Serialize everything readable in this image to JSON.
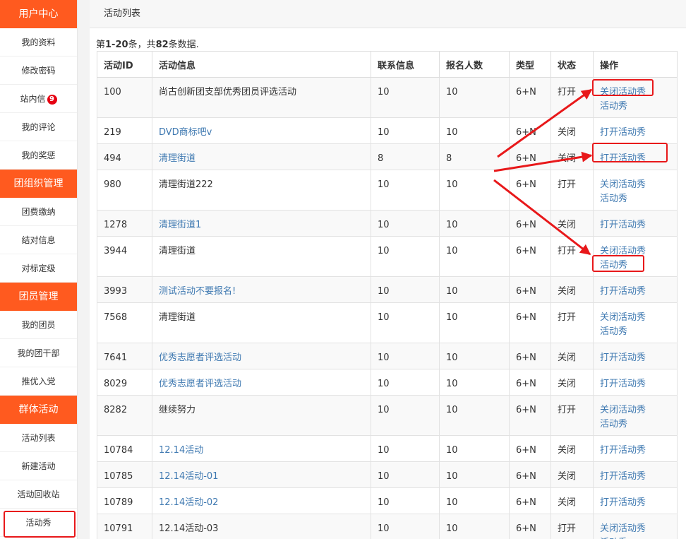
{
  "sidebar": {
    "sections": [
      {
        "title": "用户中心",
        "items": [
          {
            "label": "我的资料"
          },
          {
            "label": "修改密码"
          },
          {
            "label": "站内信",
            "badge": "9"
          },
          {
            "label": "我的评论"
          },
          {
            "label": "我的奖惩"
          }
        ]
      },
      {
        "title": "团组织管理",
        "items": [
          {
            "label": "团费缴纳"
          },
          {
            "label": "结对信息"
          },
          {
            "label": "对标定级"
          }
        ]
      },
      {
        "title": "团员管理",
        "items": [
          {
            "label": "我的团员"
          },
          {
            "label": "我的团干部"
          },
          {
            "label": "推优入党"
          }
        ]
      },
      {
        "title": "群体活动",
        "items": [
          {
            "label": "活动列表"
          },
          {
            "label": "新建活动"
          },
          {
            "label": "活动回收站"
          },
          {
            "label": "活动秀",
            "highlight": true
          }
        ]
      }
    ]
  },
  "main": {
    "title": "活动列表",
    "summary": {
      "prefix": "第",
      "range": "1-20",
      "middle": "条，共",
      "total": "82",
      "suffix": "条数据."
    },
    "columns": [
      "活动ID",
      "活动信息",
      "联系信息",
      "报名人数",
      "类型",
      "状态",
      "操作"
    ],
    "rows": [
      {
        "id": "100",
        "info": "尚古创新团支部优秀团员评选活动",
        "info_link": false,
        "contact": "10",
        "count": "10",
        "type": "6+N",
        "status": "打开",
        "ops": [
          "关闭活动秀",
          "活动秀"
        ]
      },
      {
        "id": "219",
        "info": "DVD商标吧v",
        "info_link": true,
        "contact": "10",
        "count": "10",
        "type": "6+N",
        "status": "关闭",
        "ops": [
          "打开活动秀"
        ]
      },
      {
        "id": "494",
        "info": "清理街道",
        "info_link": true,
        "contact": "8",
        "count": "8",
        "type": "6+N",
        "status": "关闭",
        "ops": [
          "打开活动秀"
        ]
      },
      {
        "id": "980",
        "info": "清理街道222",
        "info_link": false,
        "contact": "10",
        "count": "10",
        "type": "6+N",
        "status": "打开",
        "ops": [
          "关闭活动秀",
          "活动秀"
        ]
      },
      {
        "id": "1278",
        "info": "清理街道1",
        "info_link": true,
        "contact": "10",
        "count": "10",
        "type": "6+N",
        "status": "关闭",
        "ops": [
          "打开活动秀"
        ]
      },
      {
        "id": "3944",
        "info": "清理街道",
        "info_link": false,
        "contact": "10",
        "count": "10",
        "type": "6+N",
        "status": "打开",
        "ops": [
          "关闭活动秀",
          "活动秀"
        ]
      },
      {
        "id": "3993",
        "info": "测试活动不要报名!",
        "info_link": true,
        "contact": "10",
        "count": "10",
        "type": "6+N",
        "status": "关闭",
        "ops": [
          "打开活动秀"
        ]
      },
      {
        "id": "7568",
        "info": "清理街道",
        "info_link": false,
        "contact": "10",
        "count": "10",
        "type": "6+N",
        "status": "打开",
        "ops": [
          "关闭活动秀",
          "活动秀"
        ]
      },
      {
        "id": "7641",
        "info": "优秀志愿者评选活动",
        "info_link": true,
        "contact": "10",
        "count": "10",
        "type": "6+N",
        "status": "关闭",
        "ops": [
          "打开活动秀"
        ]
      },
      {
        "id": "8029",
        "info": "优秀志愿者评选活动",
        "info_link": true,
        "contact": "10",
        "count": "10",
        "type": "6+N",
        "status": "关闭",
        "ops": [
          "打开活动秀"
        ]
      },
      {
        "id": "8282",
        "info": "继续努力",
        "info_link": false,
        "contact": "10",
        "count": "10",
        "type": "6+N",
        "status": "打开",
        "ops": [
          "关闭活动秀",
          "活动秀"
        ]
      },
      {
        "id": "10784",
        "info": "12.14活动",
        "info_link": true,
        "contact": "10",
        "count": "10",
        "type": "6+N",
        "status": "关闭",
        "ops": [
          "打开活动秀"
        ]
      },
      {
        "id": "10785",
        "info": "12.14活动-01",
        "info_link": true,
        "contact": "10",
        "count": "10",
        "type": "6+N",
        "status": "关闭",
        "ops": [
          "打开活动秀"
        ]
      },
      {
        "id": "10789",
        "info": "12.14活动-02",
        "info_link": true,
        "contact": "10",
        "count": "10",
        "type": "6+N",
        "status": "关闭",
        "ops": [
          "打开活动秀"
        ]
      },
      {
        "id": "10791",
        "info": "12.14活动-03",
        "info_link": false,
        "contact": "10",
        "count": "10",
        "type": "6+N",
        "status": "打开",
        "ops": [
          "关闭活动秀",
          "活动秀"
        ]
      }
    ]
  },
  "colors": {
    "accent": "#ff5a1f",
    "link": "#3f79b1",
    "annotation": "#e8181a",
    "badge": "#e60012"
  }
}
